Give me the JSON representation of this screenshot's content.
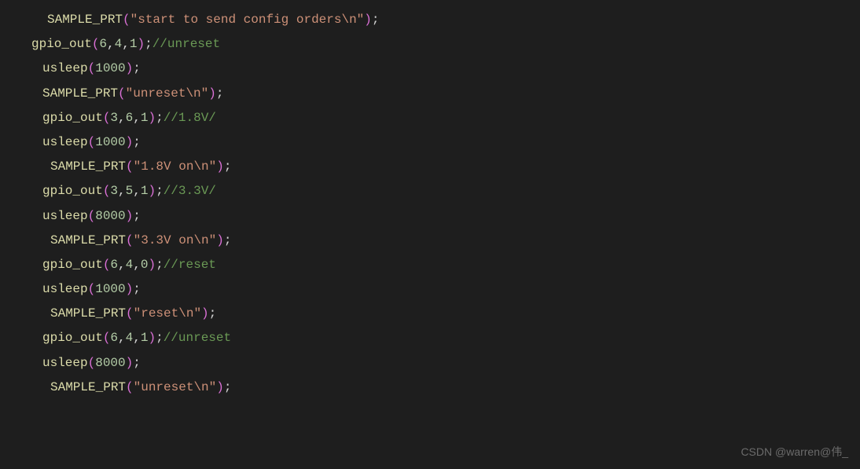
{
  "code": {
    "line1": {
      "func": "SAMPLE_PRT",
      "arg": "\"start to send config orders\\n\""
    },
    "line2": {
      "func": "gpio_out",
      "args": [
        "6",
        "4",
        "1"
      ],
      "comment": "//unreset"
    },
    "line3": {
      "func": "usleep",
      "arg": "1000"
    },
    "line4": {
      "func": "SAMPLE_PRT",
      "arg": "\"unreset\\n\""
    },
    "line5": {
      "func": "gpio_out",
      "args": [
        "3",
        "6",
        "1"
      ],
      "comment": "//1.8V/"
    },
    "line6": {
      "func": "usleep",
      "arg": "1000"
    },
    "line7": {
      "func": "SAMPLE_PRT",
      "arg": "\"1.8V on\\n\""
    },
    "line8": {
      "func": "gpio_out",
      "args": [
        "3",
        "5",
        "1"
      ],
      "comment": "//3.3V/"
    },
    "line9": {
      "func": "usleep",
      "arg": "8000"
    },
    "line10": {
      "func": "SAMPLE_PRT",
      "arg": "\"3.3V on\\n\""
    },
    "line11": {
      "func": "gpio_out",
      "args": [
        "6",
        "4",
        "0"
      ],
      "comment": "//reset"
    },
    "line12": {
      "func": "usleep",
      "arg": "1000"
    },
    "line13": {
      "func": "SAMPLE_PRT",
      "arg": "\"reset\\n\""
    },
    "line14": {
      "func": "gpio_out",
      "args": [
        "6",
        "4",
        "1"
      ],
      "comment": "//unreset"
    },
    "line15": {
      "func": "usleep",
      "arg": "8000"
    },
    "line16": {
      "func": "SAMPLE_PRT",
      "arg": "\"unreset\\n\""
    }
  },
  "watermark": "CSDN @warren@伟_"
}
